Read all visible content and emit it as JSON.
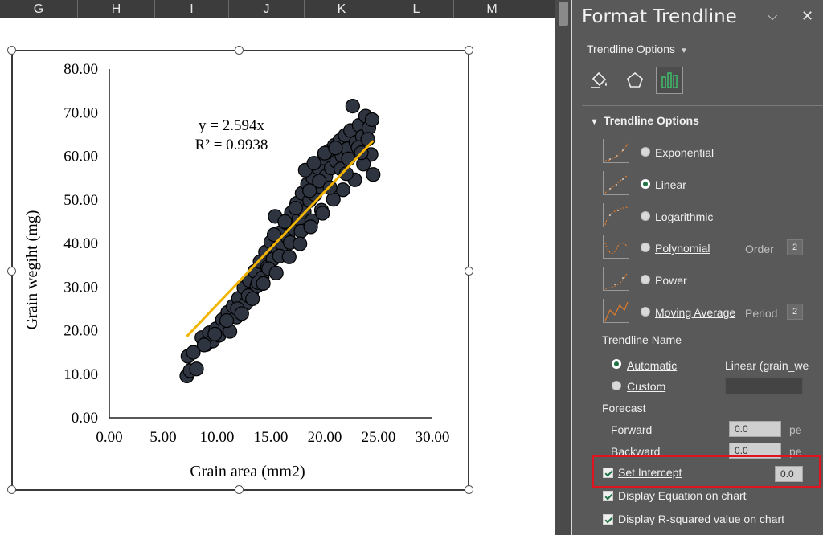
{
  "sheet": {
    "columns": [
      "G",
      "H",
      "I",
      "J",
      "K",
      "L",
      "M"
    ]
  },
  "chart_data": {
    "type": "scatter",
    "xlabel": "Grain area (mm2)",
    "ylabel": "Grain wegiht (mg)",
    "xlim": [
      0,
      30
    ],
    "ylim": [
      0,
      80
    ],
    "x_ticks": [
      "0.00",
      "5.00",
      "10.00",
      "15.00",
      "20.00",
      "25.00",
      "30.00"
    ],
    "y_ticks": [
      "0.00",
      "10.00",
      "20.00",
      "30.00",
      "40.00",
      "50.00",
      "60.00",
      "70.00",
      "80.00"
    ],
    "trendline": {
      "type": "linear",
      "slope": 2.594,
      "intercept": 0,
      "x_range": [
        7.2,
        24.5
      ],
      "color": "#f2b400"
    },
    "equation": "y = 2.594x",
    "r_squared": "R² = 0.9938",
    "marker_color": "#2e3440",
    "points": [
      [
        7.2,
        9.6
      ],
      [
        7.5,
        10.8
      ],
      [
        7.3,
        14.1
      ],
      [
        7.8,
        15.0
      ],
      [
        8.1,
        11.2
      ],
      [
        8.6,
        18.4
      ],
      [
        9.0,
        16.8
      ],
      [
        9.3,
        19.5
      ],
      [
        9.6,
        17.6
      ],
      [
        9.9,
        20.4
      ],
      [
        10.2,
        18.9
      ],
      [
        10.5,
        22.5
      ],
      [
        10.8,
        21.0
      ],
      [
        11.0,
        24.2
      ],
      [
        11.2,
        19.8
      ],
      [
        11.5,
        25.6
      ],
      [
        11.8,
        23.1
      ],
      [
        12.0,
        27.4
      ],
      [
        12.2,
        24.6
      ],
      [
        12.5,
        29.8
      ],
      [
        12.7,
        26.2
      ],
      [
        13.0,
        31.5
      ],
      [
        13.2,
        28.4
      ],
      [
        13.5,
        33.6
      ],
      [
        13.7,
        30.2
      ],
      [
        14.0,
        35.8
      ],
      [
        14.2,
        32.1
      ],
      [
        14.5,
        38.0
      ],
      [
        14.7,
        34.6
      ],
      [
        15.0,
        40.3
      ],
      [
        15.2,
        36.4
      ],
      [
        15.4,
        46.2
      ],
      [
        15.6,
        38.9
      ],
      [
        15.9,
        42.5
      ],
      [
        16.1,
        39.7
      ],
      [
        16.4,
        44.8
      ],
      [
        16.6,
        41.2
      ],
      [
        16.9,
        47.0
      ],
      [
        17.1,
        43.5
      ],
      [
        17.4,
        49.2
      ],
      [
        17.6,
        45.6
      ],
      [
        17.9,
        51.5
      ],
      [
        18.1,
        47.3
      ],
      [
        18.4,
        53.6
      ],
      [
        18.6,
        49.8
      ],
      [
        18.9,
        55.1
      ],
      [
        19.1,
        51.2
      ],
      [
        19.4,
        57.4
      ],
      [
        19.6,
        53.0
      ],
      [
        19.9,
        59.6
      ],
      [
        20.1,
        55.4
      ],
      [
        20.4,
        61.2
      ],
      [
        20.6,
        57.3
      ],
      [
        20.9,
        62.5
      ],
      [
        21.1,
        58.8
      ],
      [
        21.4,
        63.6
      ],
      [
        21.6,
        60.1
      ],
      [
        21.9,
        64.8
      ],
      [
        22.1,
        61.7
      ],
      [
        22.4,
        65.9
      ],
      [
        22.6,
        71.5
      ],
      [
        22.9,
        63.2
      ],
      [
        23.2,
        67.1
      ],
      [
        23.5,
        64.5
      ],
      [
        23.8,
        69.2
      ],
      [
        24.1,
        66.5
      ],
      [
        24.4,
        68.4
      ],
      [
        24.5,
        55.8
      ],
      [
        24.3,
        60.4
      ],
      [
        23.6,
        58.2
      ],
      [
        22.8,
        54.6
      ],
      [
        21.7,
        52.3
      ],
      [
        20.8,
        50.1
      ],
      [
        19.7,
        47.6
      ],
      [
        18.8,
        45.2
      ],
      [
        17.8,
        42.8
      ],
      [
        16.8,
        40.2
      ],
      [
        15.8,
        37.1
      ],
      [
        14.8,
        34.2
      ],
      [
        13.8,
        31.0
      ],
      [
        12.9,
        28.0
      ],
      [
        11.9,
        25.0
      ],
      [
        10.9,
        22.3
      ],
      [
        9.8,
        19.2
      ],
      [
        8.8,
        16.7
      ],
      [
        18.2,
        56.8
      ],
      [
        19.0,
        58.4
      ],
      [
        20.0,
        60.7
      ],
      [
        21.0,
        61.9
      ],
      [
        19.5,
        54.3
      ],
      [
        18.6,
        52.1
      ],
      [
        17.3,
        48.1
      ],
      [
        16.3,
        45.0
      ],
      [
        15.3,
        42.0
      ],
      [
        20.5,
        52.8
      ],
      [
        21.5,
        57.1
      ],
      [
        22.2,
        59.4
      ],
      [
        23.1,
        62.0
      ],
      [
        16.7,
        36.9
      ],
      [
        17.7,
        39.9
      ],
      [
        18.7,
        43.8
      ],
      [
        19.8,
        46.9
      ],
      [
        14.3,
        30.8
      ],
      [
        13.3,
        27.3
      ],
      [
        12.3,
        23.9
      ],
      [
        15.5,
        33.2
      ],
      [
        22.0,
        56.0
      ],
      [
        23.4,
        60.8
      ],
      [
        24.0,
        63.9
      ]
    ]
  },
  "pane": {
    "title": "Format Trendline",
    "options_dropdown": "Trendline Options",
    "section_title": "Trendline Options",
    "types": [
      {
        "label": "Exponential",
        "underline_char": "x",
        "selected": false
      },
      {
        "label": "Linear",
        "selected": true
      },
      {
        "label": "Logarithmic",
        "selected": false
      },
      {
        "label": "Polynomial",
        "selected": false
      },
      {
        "label": "Power",
        "selected": false
      },
      {
        "label": "Moving Average",
        "selected": false
      }
    ],
    "order_label": "Order",
    "order_value": "2",
    "period_label": "Period",
    "period_value": "2",
    "trendline_name_label": "Trendline Name",
    "automatic_label": "Automatic",
    "automatic_value": "Linear (grain_we",
    "custom_label": "Custom",
    "forecast_label": "Forecast",
    "forward_label": "Forward",
    "forward_value": "0.0",
    "forward_unit": "pe",
    "backward_label": "Backward",
    "backward_value": "0.0",
    "backward_unit": "pe",
    "set_intercept_label": "Set Intercept",
    "set_intercept_value": "0.0",
    "display_equation_label": "Display Equation on chart",
    "display_r2_label": "Display R-squared value on chart",
    "accent_color": "#217346",
    "highlight_color": "#e0141e"
  }
}
